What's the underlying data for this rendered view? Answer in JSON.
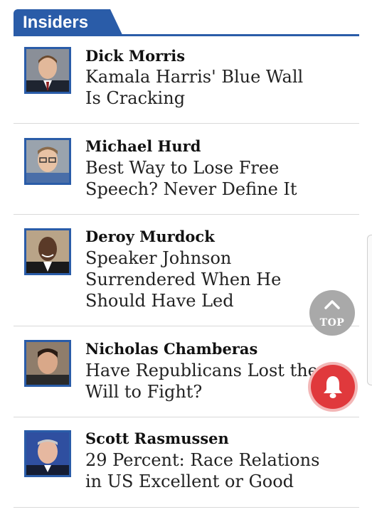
{
  "section": {
    "title": "Insiders"
  },
  "articles": [
    {
      "author": "Dick Morris",
      "headline": "Kamala Harris' Blue Wall Is Cracking"
    },
    {
      "author": "Michael Hurd",
      "headline": "Best Way to Lose Free Speech? Never Define It"
    },
    {
      "author": "Deroy Murdock",
      "headline": "Speaker Johnson Surrendered When He Should Have Led"
    },
    {
      "author": "Nicholas Chamberas",
      "headline": "Have Republicans Lost the Will to Fight?"
    },
    {
      "author": "Scott Rasmussen",
      "headline": "29 Percent: Race Relations in US Excellent or Good"
    }
  ],
  "back_to_top": {
    "label": "TOP",
    "icon": "chevron-up-icon"
  },
  "notification": {
    "icon": "bell-icon",
    "color": "#e0393c"
  },
  "colors": {
    "brand": "#2a5ca8"
  }
}
